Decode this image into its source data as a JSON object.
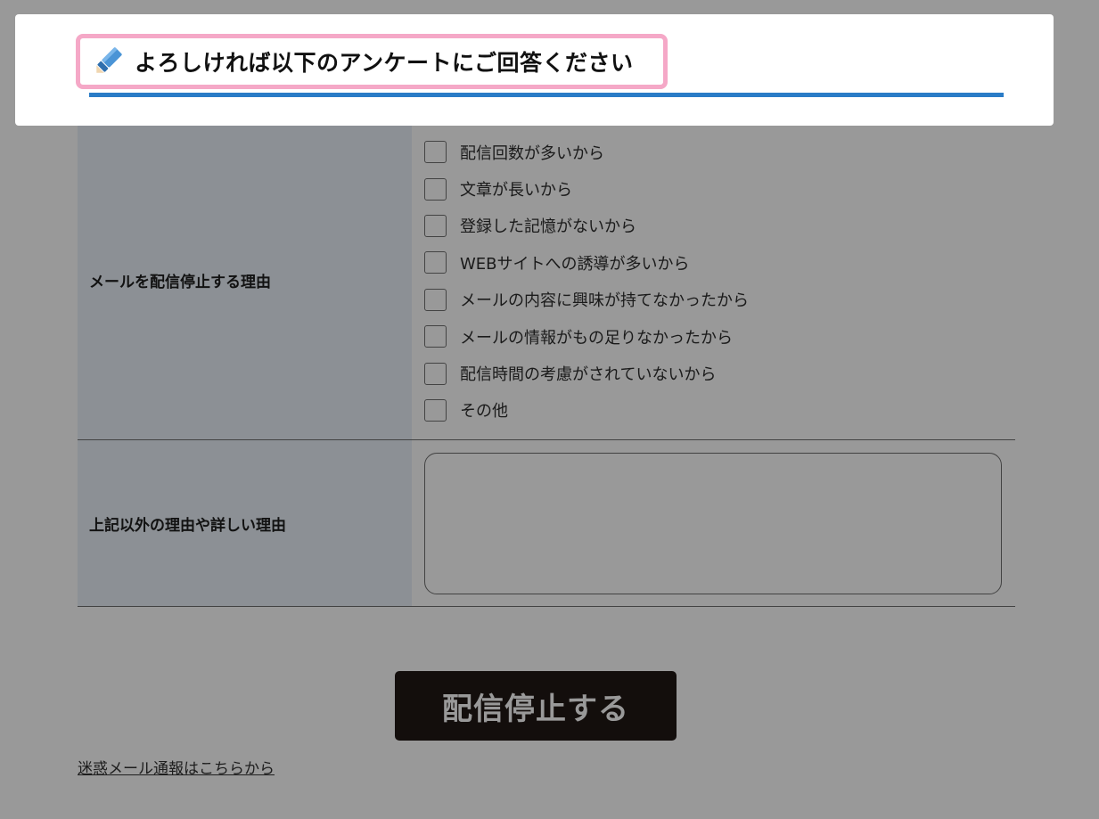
{
  "survey": {
    "reasons_label": "メールを配信停止する理由",
    "reasons": [
      "配信回数が多いから",
      "文章が長いから",
      "登録した記憶がないから",
      "WEBサイトへの誘導が多いから",
      "メールの内容に興味が持てなかったから",
      "メールの情報がもの足りなかったから",
      "配信時間の考慮がされていないから",
      "その他"
    ],
    "details_label": "上記以外の理由や詳しい理由",
    "details_value": ""
  },
  "submit_label": "配信停止する",
  "report_link": "迷惑メール通報はこちらから",
  "popup": {
    "heading": "よろしければ以下のアンケートにご回答ください",
    "icon": "pencil-icon"
  },
  "colors": {
    "accent_blue": "#2a7cc7",
    "heading_border_pink": "#f5a8c7",
    "button_bg": "#211815",
    "label_bg": "#e9f1f8"
  }
}
